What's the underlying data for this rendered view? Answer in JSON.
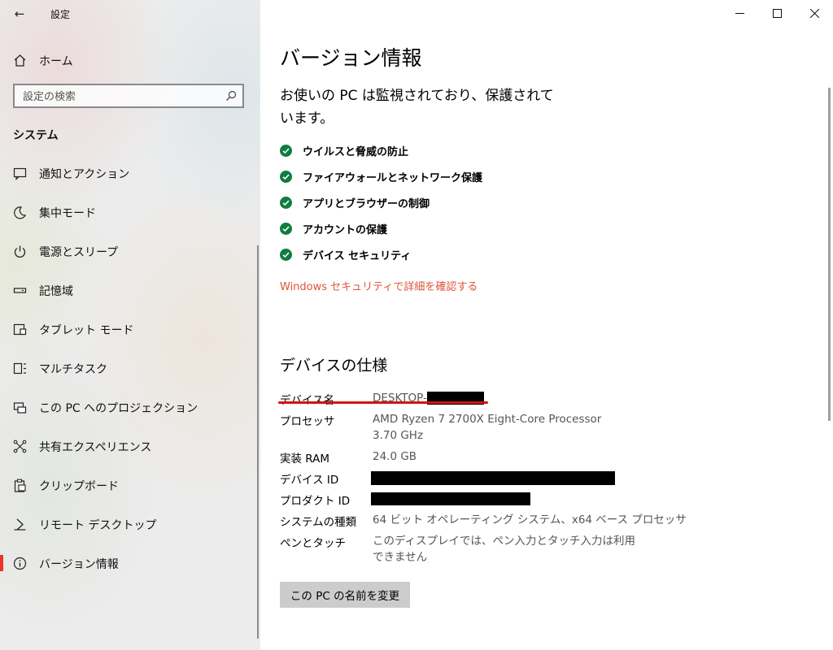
{
  "window": {
    "title": "設定",
    "back_icon": "←",
    "controls": [
      "minimize-icon",
      "maximize-icon",
      "close-icon"
    ]
  },
  "sidebar": {
    "home_label": "ホーム",
    "search_placeholder": "設定の検索",
    "section_title": "システム",
    "items": [
      {
        "label": "通知とアクション",
        "icon": "notification-icon"
      },
      {
        "label": "集中モード",
        "icon": "moon-icon"
      },
      {
        "label": "電源とスリープ",
        "icon": "power-icon"
      },
      {
        "label": "記憶域",
        "icon": "storage-icon"
      },
      {
        "label": "タブレット モード",
        "icon": "tablet-icon"
      },
      {
        "label": "マルチタスク",
        "icon": "multitask-icon"
      },
      {
        "label": "この PC へのプロジェクション",
        "icon": "projection-icon"
      },
      {
        "label": "共有エクスペリエンス",
        "icon": "share-icon"
      },
      {
        "label": "クリップボード",
        "icon": "clipboard-icon"
      },
      {
        "label": "リモート デスクトップ",
        "icon": "remote-desktop-icon"
      },
      {
        "label": "バージョン情報",
        "icon": "info-icon",
        "selected": true
      }
    ]
  },
  "main": {
    "title": "バージョン情報",
    "protection_message": "お使いの PC は監視されており、保護されています。",
    "protections": [
      "ウイルスと脅威の防止",
      "ファイアウォールとネットワーク保護",
      "アプリとブラウザーの制御",
      "アカウントの保護",
      "デバイス セキュリティ"
    ],
    "security_link": "Windows セキュリティで詳細を確認する",
    "specs_title": "デバイスの仕様",
    "specs": {
      "device_name_label": "デバイス名",
      "device_name_value": "DESKTOP-",
      "processor_label": "プロセッサ",
      "processor_value": "AMD Ryzen 7 2700X Eight-Core Processor",
      "processor_speed": "3.70 GHz",
      "ram_label": "実装 RAM",
      "ram_value": "24.0 GB",
      "device_id_label": "デバイス ID",
      "product_id_label": "プロダクト ID",
      "system_type_label": "システムの種類",
      "system_type_value": "64 ビット オペレーティング システム、x64 ベース プロセッサ",
      "pen_touch_label": "ペンとタッチ",
      "pen_touch_value": "このディスプレイでは、ペン入力とタッチ入力は利用できません"
    },
    "rename_button": "この PC の名前を変更"
  },
  "colors": {
    "accent_red": "#e8362d",
    "link_orange": "#e0533a",
    "check_green": "#107c41",
    "annotation_red": "#d21414"
  }
}
